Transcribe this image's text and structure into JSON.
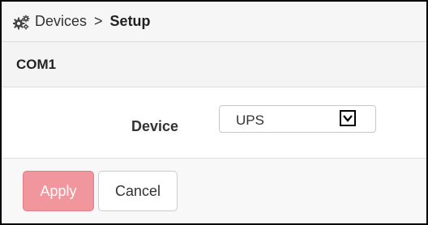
{
  "breadcrumb": {
    "icon": "gears-icon",
    "parent": "Devices",
    "separator": ">",
    "current": "Setup"
  },
  "section": {
    "title": "COM1"
  },
  "form": {
    "device_label": "Device",
    "device_select": {
      "value": "UPS",
      "icon": "chevron-down-icon"
    }
  },
  "actions": {
    "apply_label": "Apply",
    "cancel_label": "Cancel"
  },
  "colors": {
    "apply_bg": "#f2969d",
    "apply_border": "#e07b84",
    "header_bg": "#f6f6f6",
    "section_bg": "#f4f4f4"
  }
}
